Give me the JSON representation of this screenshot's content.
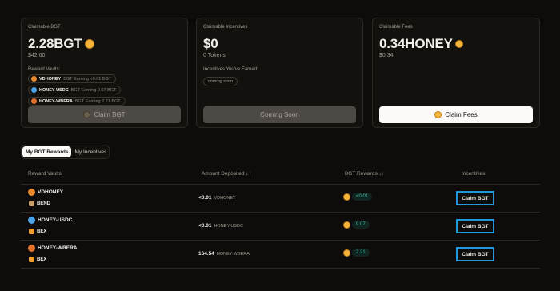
{
  "cards": {
    "bgt": {
      "label": "Claimable BGT",
      "amount": "2.28BGT",
      "usd": "$42.60",
      "vaults_label": "Reward Vaults:",
      "vaults": [
        {
          "name": "VDHONEY",
          "detail": "BGT Earning <0.01 BGT",
          "color": "#e8892c"
        },
        {
          "name": "HONEY-USDC",
          "detail": "BGT Earning 0.07 BGT",
          "color": "#4aa3e8"
        },
        {
          "name": "HONEY-WBERA",
          "detail": "BGT Earning 2.21 BGT",
          "color": "#e0722a"
        }
      ],
      "button": "Claim BGT"
    },
    "incentives": {
      "label": "Claimable Incentives",
      "amount": "$0",
      "tokens": "0 Tokens",
      "earned_label": "Incentives You've Earned:",
      "earned_value": "coming soon",
      "button": "Coming Soon"
    },
    "fees": {
      "label": "Claimable Fees",
      "amount": "0.34HONEY",
      "usd": "$0.34",
      "button": "Claim Fees"
    }
  },
  "tabs": [
    "My BGT Rewards",
    "My Incentives"
  ],
  "table": {
    "headers": {
      "vault": "Reward Vaults",
      "amount": "Amount Deposited ↓↑",
      "rewards": "BGT Rewards ↓↑",
      "incentives": "Incentives"
    },
    "rows": [
      {
        "vault": "VDHONEY",
        "source": "BEND",
        "amount": "<0.01",
        "unit": "VDHONEY",
        "reward": "<0.01",
        "action": "Claim BGT",
        "color": "#e8892c",
        "src_color": "#c9a06b"
      },
      {
        "vault": "HONEY-USDC",
        "source": "BEX",
        "amount": "<0.01",
        "unit": "HONEY-USDC",
        "reward": "0.07",
        "action": "Claim BGT",
        "color": "#4aa3e8",
        "src_color": "#f0a030"
      },
      {
        "vault": "HONEY-WBERA",
        "source": "BEX",
        "amount": "164.54",
        "unit": "HONEY-WBERA",
        "reward": "2.21",
        "action": "Claim BGT",
        "color": "#e0722a",
        "src_color": "#f0a030"
      }
    ]
  },
  "accent": "#2196d9",
  "coin_color": "#f5b43a"
}
